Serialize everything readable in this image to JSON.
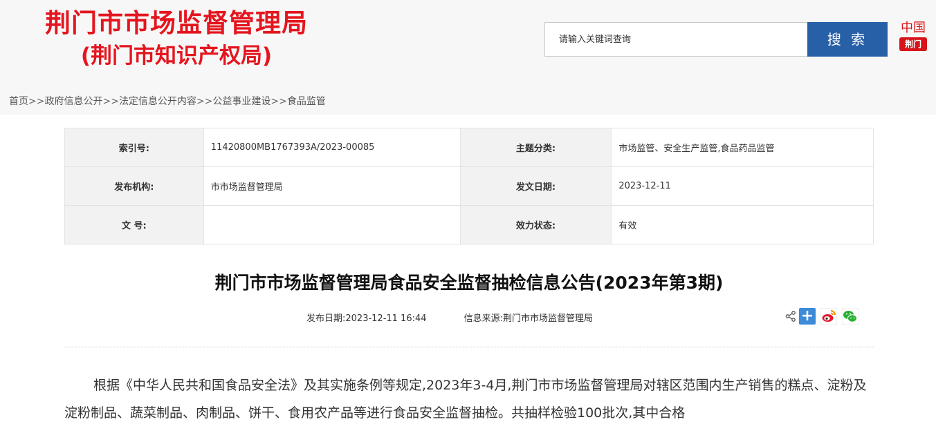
{
  "header": {
    "title_line1": "荆门市市场监督管理局",
    "title_line2": "(荆门市知识产权局)",
    "search_placeholder": "请输入关键词查询",
    "search_button": "搜 索",
    "logo_top": "中国",
    "logo_bottom": "荆门"
  },
  "breadcrumb": [
    "首页",
    "政府信息公开",
    "法定信息公开内容",
    "公益事业建设",
    "食品监管"
  ],
  "breadcrumb_sep": ">>",
  "info": {
    "index_label": "索引号:",
    "index_value": "11420800MB1767393A/2023-00085",
    "topic_label": "主题分类:",
    "topic_value": "市场监管、安全生产监管,食品药品监管",
    "org_label": "发布机构:",
    "org_value": "市市场监督管理局",
    "date_label": "发文日期:",
    "date_value": "2023-12-11",
    "docno_label": "文 号:",
    "docno_value": "",
    "status_label": "效力状态:",
    "status_value": "有效"
  },
  "article": {
    "title": "荆门市市场监督管理局食品安全监督抽检信息公告(2023年第3期)",
    "publish_date": "发布日期:2023-12-11 16:44",
    "source": "信息来源:荆门市市场监督管理局",
    "body": "根据《中华人民共和国食品安全法》及其实施条例等规定,2023年3-4月,荆门市市场监督管理局对辖区范围内生产销售的糕点、淀粉及淀粉制品、蔬菜制品、肉制品、饼干、食用农产品等进行食品安全监督抽检。共抽样检验100批次,其中合格"
  },
  "colors": {
    "brand_red": "#e4151e",
    "search_blue": "#2860a8"
  },
  "icons": [
    "share-icon",
    "plus-share-icon",
    "weibo-icon",
    "wechat-icon"
  ]
}
